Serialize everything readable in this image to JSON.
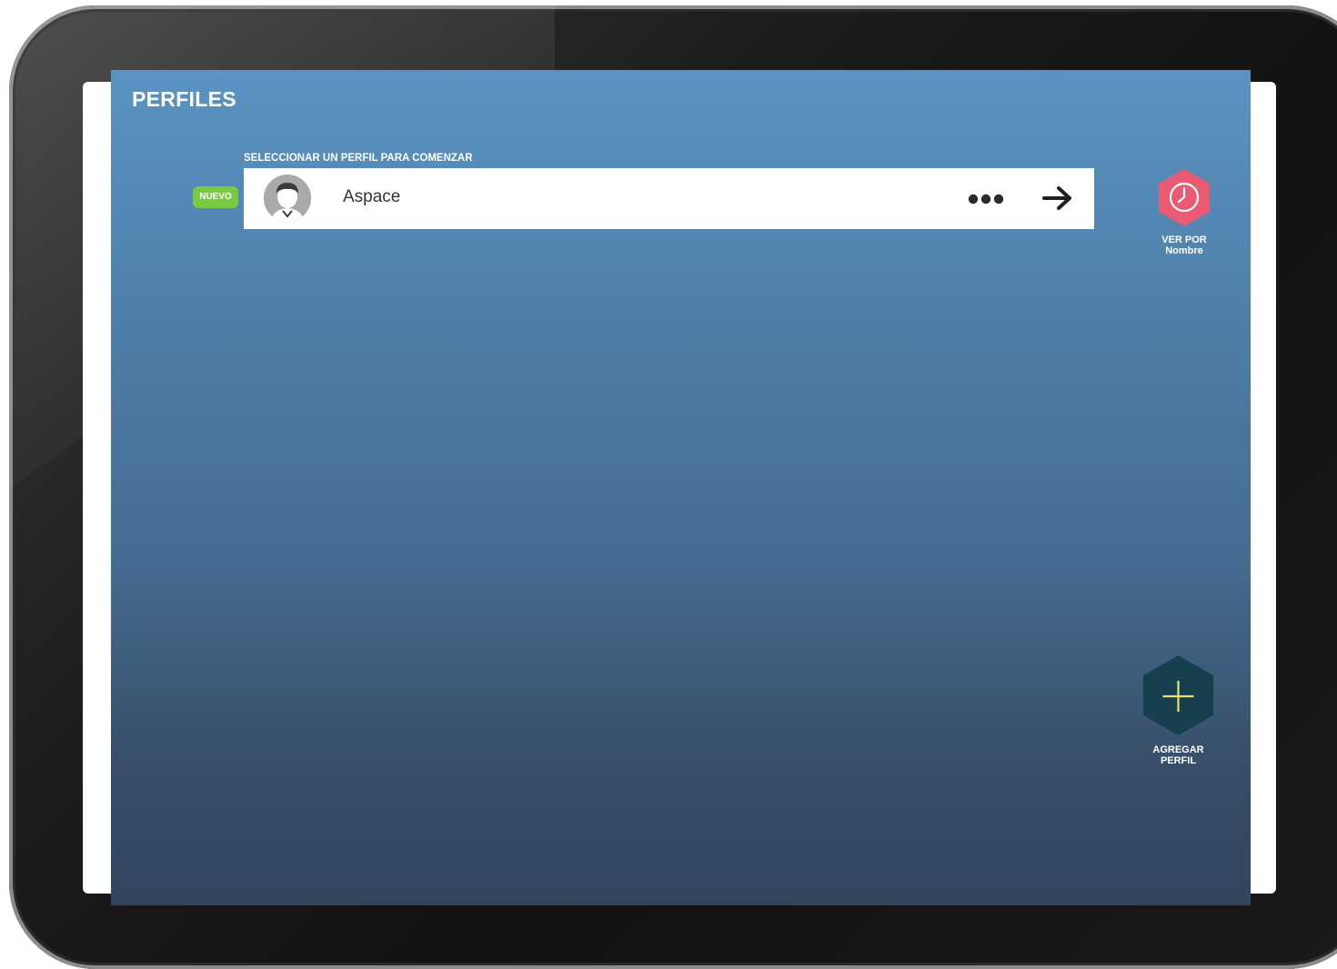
{
  "header": {
    "title": "PERFILES"
  },
  "profiles": {
    "instruction": "SELECCIONAR UN PERFIL PARA COMENZAR",
    "items": [
      {
        "badge": "NUEVO",
        "name": "Aspace",
        "more_icon": "ellipsis-icon",
        "open_icon": "arrow-right-icon"
      }
    ]
  },
  "sort": {
    "label_line1": "VER POR",
    "label_line2": "Nombre",
    "icon": "clock-icon"
  },
  "add_profile": {
    "label_line1": "AGREGAR",
    "label_line2": "PERFIL",
    "icon": "plus-icon"
  },
  "colors": {
    "screen_top": "#5a93c2",
    "screen_bottom": "#33455e",
    "badge_green": "#7ac943",
    "sort_hex_pink": "#ea5a72",
    "add_hex_teal": "#17404f",
    "plus_yellow": "#e6e26b"
  }
}
